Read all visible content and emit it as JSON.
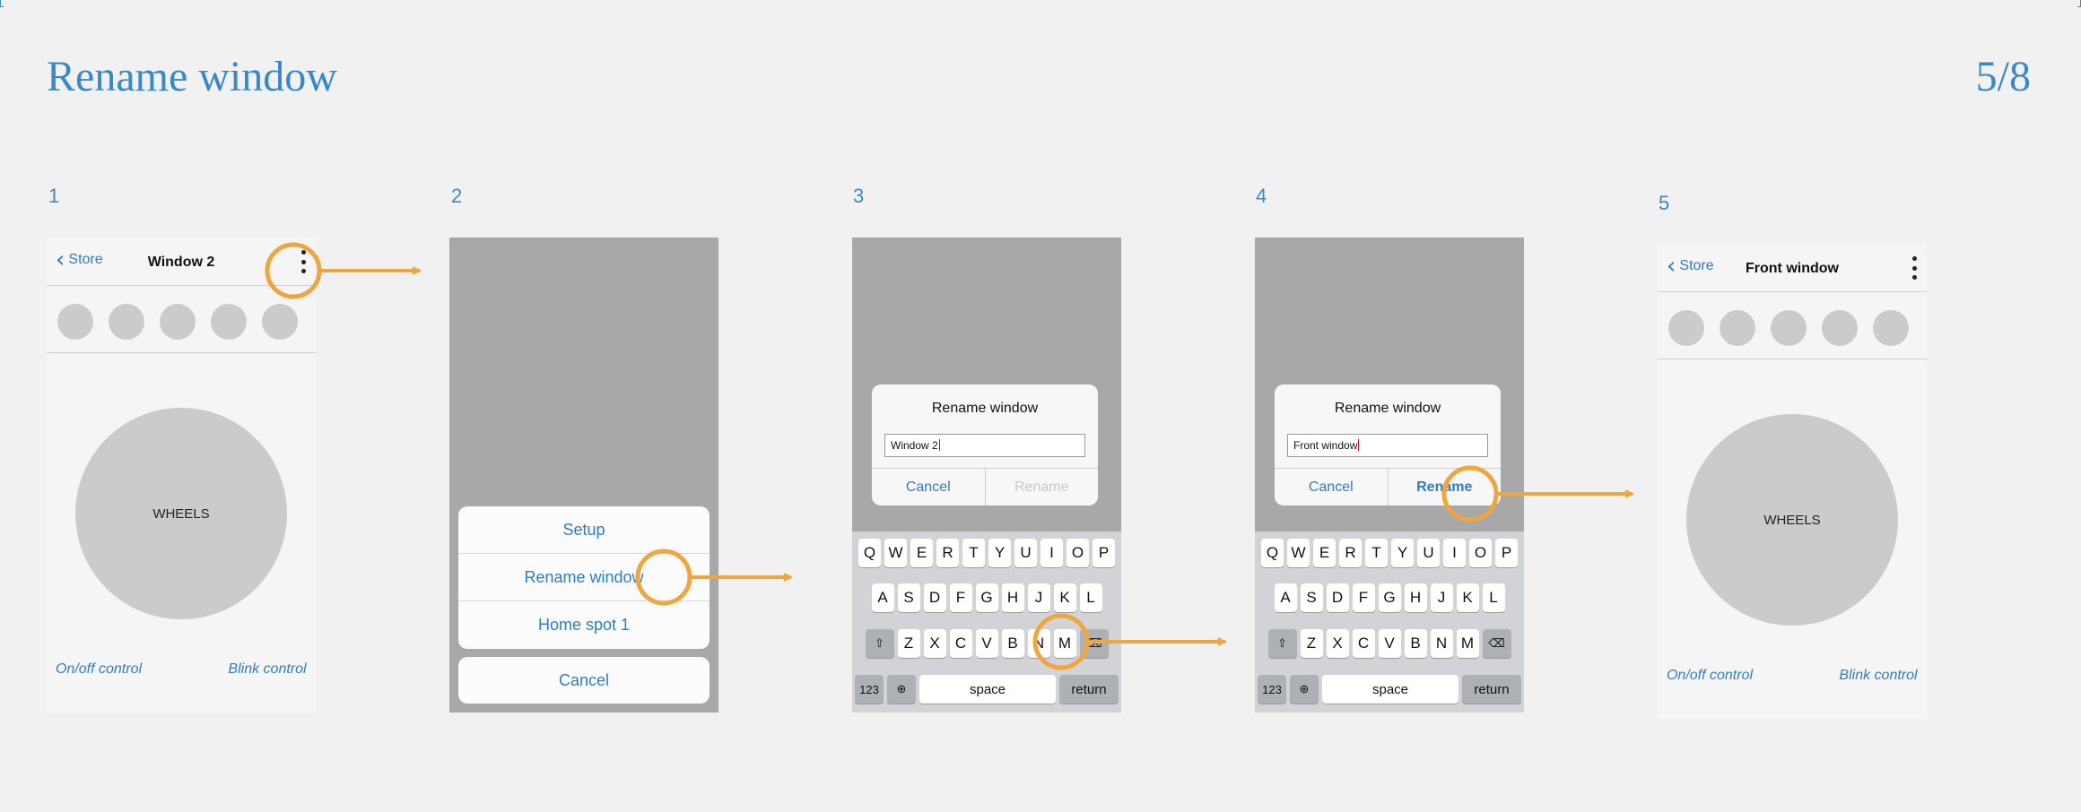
{
  "title": "Rename window",
  "page_number": "5/8",
  "steps": [
    "1",
    "2",
    "3",
    "4",
    "5"
  ],
  "screen1": {
    "back_label": "Store",
    "title": "Window 2",
    "wheel_label": "WHEELS",
    "onoff_label": "On/off control",
    "blink_label": "Blink control"
  },
  "screen2": {
    "items": [
      "Setup",
      "Rename window",
      "Home spot 1"
    ],
    "cancel": "Cancel"
  },
  "screen3": {
    "alert_title": "Rename window",
    "field_value": "Window 2",
    "cancel": "Cancel",
    "rename": "Rename"
  },
  "screen4": {
    "alert_title": "Rename window",
    "field_value": "Front window",
    "cancel": "Cancel",
    "rename": "Rename"
  },
  "screen5": {
    "back_label": "Store",
    "title": "Front window",
    "wheel_label": "WHEELS",
    "onoff_label": "On/off control",
    "blink_label": "Blink control"
  },
  "keyboard": {
    "row1": [
      "Q",
      "W",
      "E",
      "R",
      "T",
      "Y",
      "U",
      "I",
      "O",
      "P"
    ],
    "row2": [
      "A",
      "S",
      "D",
      "F",
      "G",
      "H",
      "J",
      "K",
      "L"
    ],
    "row3": [
      "Z",
      "X",
      "C",
      "V",
      "B",
      "N",
      "M"
    ],
    "numbers": "123",
    "space": "space",
    "return": "return"
  },
  "icons": {
    "back": "chevron-left-icon",
    "more": "kebab-menu-icon",
    "shift": "shift-icon",
    "delete": "backspace-icon",
    "globe": "globe-icon"
  },
  "colors": {
    "accent": "#3a87c9",
    "highlight": "#f0a640"
  }
}
